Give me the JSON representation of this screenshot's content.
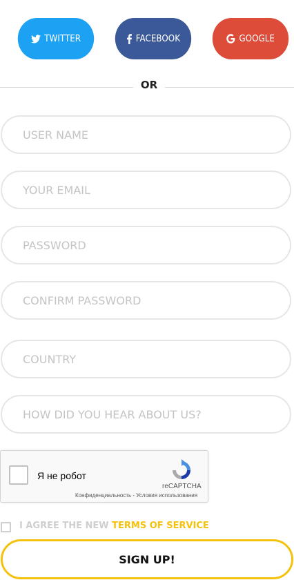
{
  "social": {
    "twitter": {
      "label": "TWITTER",
      "color": "#1da1f2",
      "icon": "twitter-icon"
    },
    "facebook": {
      "label": "FACEBOOK",
      "color": "#3b5998",
      "icon": "facebook-icon"
    },
    "google": {
      "label": "GOOGLE",
      "color": "#dd4b39",
      "icon": "google-icon"
    }
  },
  "divider": {
    "text": "OR"
  },
  "form": {
    "username": {
      "placeholder": "USER NAME",
      "value": ""
    },
    "email": {
      "placeholder": "YOUR EMAIL",
      "value": ""
    },
    "password": {
      "placeholder": "PASSWORD",
      "value": ""
    },
    "confirm_password": {
      "placeholder": "CONFIRM PASSWORD",
      "value": ""
    },
    "country": {
      "placeholder": "COUNTRY",
      "value": ""
    },
    "referral": {
      "placeholder": "HOW DID YOU HEAR ABOUT US?",
      "value": ""
    }
  },
  "captcha": {
    "label": "Я не робот",
    "brand": "reCAPTCHA",
    "links": "Конфиденциальность - Условия использования",
    "checked": false
  },
  "agree": {
    "text": "I AGREE THE NEW ",
    "link_text": "TERMS OF SERVICE",
    "link_color": "#f4c20d",
    "checked": false
  },
  "submit": {
    "label": "SIGN UP!",
    "border_color": "#f4c20d"
  }
}
